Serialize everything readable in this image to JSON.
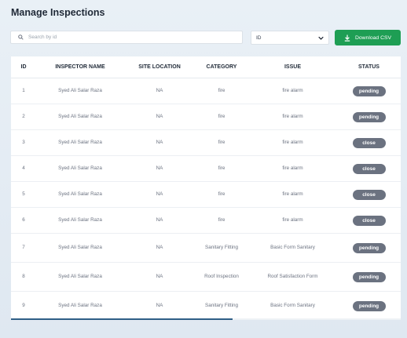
{
  "page": {
    "title": "Manage Inspections"
  },
  "toolbar": {
    "search_placeholder": "Search by id",
    "filter_selected": "ID",
    "download_label": "Download CSV"
  },
  "table": {
    "columns": [
      "ID",
      "INSPECTOR NAME",
      "SITE LOCATION",
      "CATEGORY",
      "ISSUE",
      "STATUS"
    ],
    "rows": [
      {
        "id": "1",
        "inspector": "Syed Ali Salar Raza",
        "location": "NA",
        "category": "fire",
        "issue": "fire alarm",
        "status": "pending"
      },
      {
        "id": "2",
        "inspector": "Syed Ali Salar Raza",
        "location": "NA",
        "category": "fire",
        "issue": "fire alarm",
        "status": "pending"
      },
      {
        "id": "3",
        "inspector": "Syed Ali Salar Raza",
        "location": "NA",
        "category": "fire",
        "issue": "fire alarm",
        "status": "close"
      },
      {
        "id": "4",
        "inspector": "Syed Ali Salar Raza",
        "location": "NA",
        "category": "fire",
        "issue": "fire alarm",
        "status": "close"
      },
      {
        "id": "5",
        "inspector": "Syed Ali Salar Raza",
        "location": "NA",
        "category": "fire",
        "issue": "fire alarm",
        "status": "close"
      },
      {
        "id": "6",
        "inspector": "Syed Ali Salar Raza",
        "location": "NA",
        "category": "fire",
        "issue": "fire alarm",
        "status": "close"
      },
      {
        "id": "7",
        "inspector": "Syed Ali Salar Raza",
        "location": "NA",
        "category": "Sanitary Fitting",
        "issue": "Basic Form Sanitary",
        "status": "pending"
      },
      {
        "id": "8",
        "inspector": "Syed Ali Salar Raza",
        "location": "NA",
        "category": "Roof Inspection",
        "issue": "Roof Satisfaction Form",
        "status": "pending"
      },
      {
        "id": "9",
        "inspector": "Syed Ali Salar Raza",
        "location": "NA",
        "category": "Sanitary Fitting",
        "issue": "Basic Form Sanitary",
        "status": "pending"
      }
    ]
  },
  "colors": {
    "accent_green": "#1e9e54",
    "badge_gray": "#6b7280",
    "scroll_thumb": "#2f5f86"
  },
  "icons": {
    "search": "search-icon",
    "select": "chevron-down-icon",
    "download": "download-icon"
  }
}
